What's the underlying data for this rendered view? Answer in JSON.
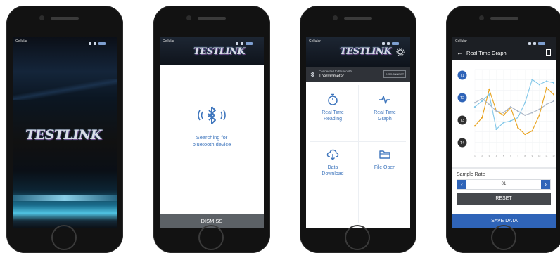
{
  "phones": [
    {
      "status": {
        "carrier": "Cellular"
      },
      "logo": "TESTLINK"
    },
    {
      "status": {
        "carrier": "Cellular"
      },
      "logo": "TESTLINK",
      "message_line1": "Searching for",
      "message_line2": "bluetooth device",
      "dismiss": "DISMISS"
    },
    {
      "status": {
        "carrier": "Cellular"
      },
      "logo": "TESTLINK",
      "device": {
        "status": "Connected to Bluetooth",
        "name": "Thermometer",
        "disconnect": "DISCONNECT"
      },
      "tiles": [
        {
          "line1": "Real Time",
          "line2": "Reading",
          "icon": "stopwatch-icon"
        },
        {
          "line1": "Real Time",
          "line2": "Graph",
          "icon": "pulse-icon"
        },
        {
          "line1": "Data",
          "line2": "Download",
          "icon": "cloud-download-icon"
        },
        {
          "line1": "File Open",
          "line2": "",
          "icon": "folder-icon"
        }
      ]
    },
    {
      "status": {
        "carrier": "Cellular"
      },
      "title": "Real Time Graph",
      "sample_rate_label": "Sample Rate",
      "sample_rate_value": "01",
      "reset": "RESET",
      "save": "SAVE DATA",
      "legend": [
        "T1",
        "T2",
        "T3",
        "T4"
      ]
    }
  ],
  "chart_data": {
    "type": "line",
    "categories": [
      "1",
      "2",
      "3",
      "4",
      "5",
      "6",
      "7",
      "8",
      "9",
      "10",
      "11",
      "12"
    ],
    "series": [
      {
        "name": "T1",
        "color": "#7fc6e8",
        "values": [
          55,
          62,
          70,
          28,
          36,
          38,
          42,
          60,
          88,
          82,
          86,
          84
        ]
      },
      {
        "name": "T2",
        "color": "#e8a21c",
        "values": [
          32,
          42,
          76,
          50,
          45,
          54,
          30,
          22,
          26,
          45,
          78,
          70
        ]
      },
      {
        "name": "T3",
        "color": "#a9b4c4",
        "values": [
          60,
          65,
          58,
          50,
          48,
          55,
          50,
          45,
          48,
          52,
          58,
          62
        ]
      }
    ],
    "ylim": [
      0,
      100
    ],
    "grid": true
  }
}
